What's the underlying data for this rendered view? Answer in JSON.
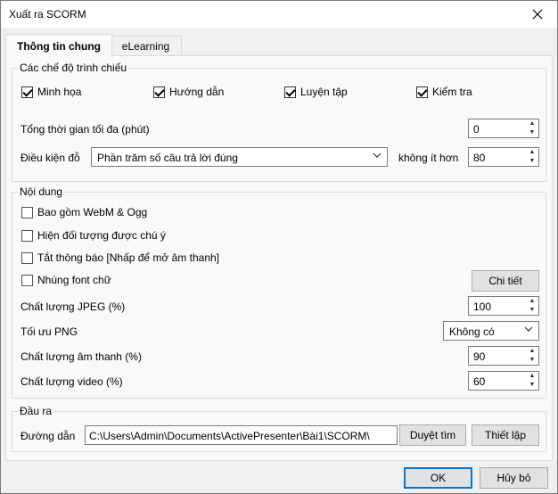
{
  "window": {
    "title": "Xuất ra SCORM"
  },
  "tabs": [
    {
      "label": "Thông tin chung"
    },
    {
      "label": "eLearning"
    }
  ],
  "modes": {
    "group_label": "Các chế độ trình chiếu",
    "items": [
      {
        "label": "Minh họa",
        "checked": true
      },
      {
        "label": "Hướng dẫn",
        "checked": true
      },
      {
        "label": "Luyện tập",
        "checked": true
      },
      {
        "label": "Kiểm tra",
        "checked": true
      }
    ],
    "max_time_label": "Tổng thời gian tối đa (phút)",
    "max_time_value": "0",
    "pass_label": "Điều kiện đỗ",
    "pass_select": "Phần trăm số câu trả lời đúng",
    "not_less_label": "không ít hơn",
    "not_less_value": "80"
  },
  "content": {
    "group_label": "Nội dung",
    "items": [
      {
        "label": "Bao gồm WebM & Ogg",
        "checked": false
      },
      {
        "label": "Hiện đối tượng được chú ý",
        "checked": false
      },
      {
        "label": "Tắt thông báo [Nhấp để mở âm thanh]",
        "checked": false
      },
      {
        "label": "Nhúng font chữ",
        "checked": false
      }
    ],
    "details_button": "Chi tiết",
    "jpeg_label": "Chất lượng JPEG (%)",
    "jpeg_value": "100",
    "png_label": "Tối ưu PNG",
    "png_value": "Không có",
    "audio_label": "Chất lượng âm thanh (%)",
    "audio_value": "90",
    "video_label": "Chất lượng video (%)",
    "video_value": "60"
  },
  "output": {
    "group_label": "Đầu ra",
    "path_label": "Đường dẫn",
    "path_value": "C:\\Users\\Admin\\Documents\\ActivePresenter\\Bài1\\SCORM\\",
    "browse_button": "Duyệt tìm",
    "setup_button": "Thiết lập"
  },
  "footer": {
    "ok": "OK",
    "cancel": "Hủy bỏ"
  }
}
